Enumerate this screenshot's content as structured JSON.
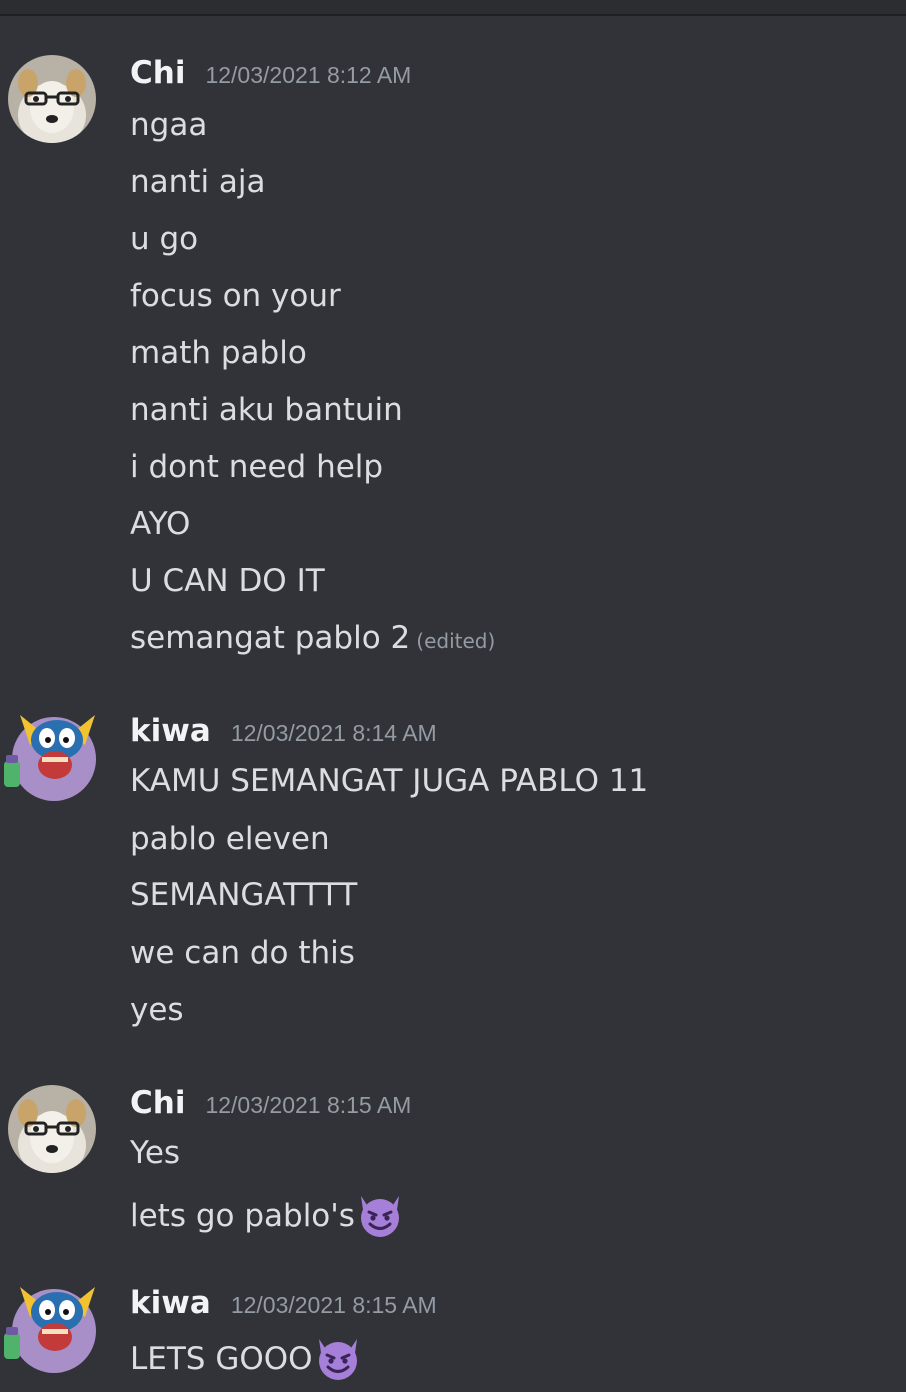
{
  "groups": [
    {
      "author": "Chi",
      "timestamp": "12/03/2021 8:12 AM",
      "avatar_icon": "dog-with-glasses-avatar",
      "messages": [
        {
          "text": "ngaa"
        },
        {
          "text": "nanti aja"
        },
        {
          "text": "u go"
        },
        {
          "text": "focus on your"
        },
        {
          "text": "math pablo"
        },
        {
          "text": "nanti aku bantuin"
        },
        {
          "text": "i dont need help"
        },
        {
          "text": "AYO"
        },
        {
          "text": "U CAN DO IT"
        },
        {
          "text": "semangat pablo 2",
          "edited": "(edited)"
        }
      ]
    },
    {
      "author": "kiwa",
      "timestamp": "12/03/2021 8:14 AM",
      "avatar_icon": "cartoon-character-avatar",
      "messages": [
        {
          "text": "KAMU SEMANGAT JUGA PABLO 11"
        },
        {
          "text": "pablo eleven"
        },
        {
          "text": "SEMANGATTTT"
        },
        {
          "text": "we can do this"
        },
        {
          "text": "yes"
        }
      ]
    },
    {
      "author": "Chi",
      "timestamp": "12/03/2021 8:15 AM",
      "avatar_icon": "dog-with-glasses-avatar",
      "messages": [
        {
          "text": "Yes"
        },
        {
          "text": "lets go pablo's",
          "emoji": "smiling-imp-emoji"
        }
      ]
    },
    {
      "author": "kiwa",
      "timestamp": "12/03/2021 8:15 AM",
      "avatar_icon": "cartoon-character-avatar",
      "messages": [
        {
          "text": "LETS GOOO",
          "emoji": "smiling-imp-emoji"
        }
      ]
    }
  ],
  "colors": {
    "background": "#313338",
    "username": "#f2f3f5",
    "text": "#dbdee1",
    "muted": "#949ba4",
    "emoji_purple": "#a67fd9"
  }
}
